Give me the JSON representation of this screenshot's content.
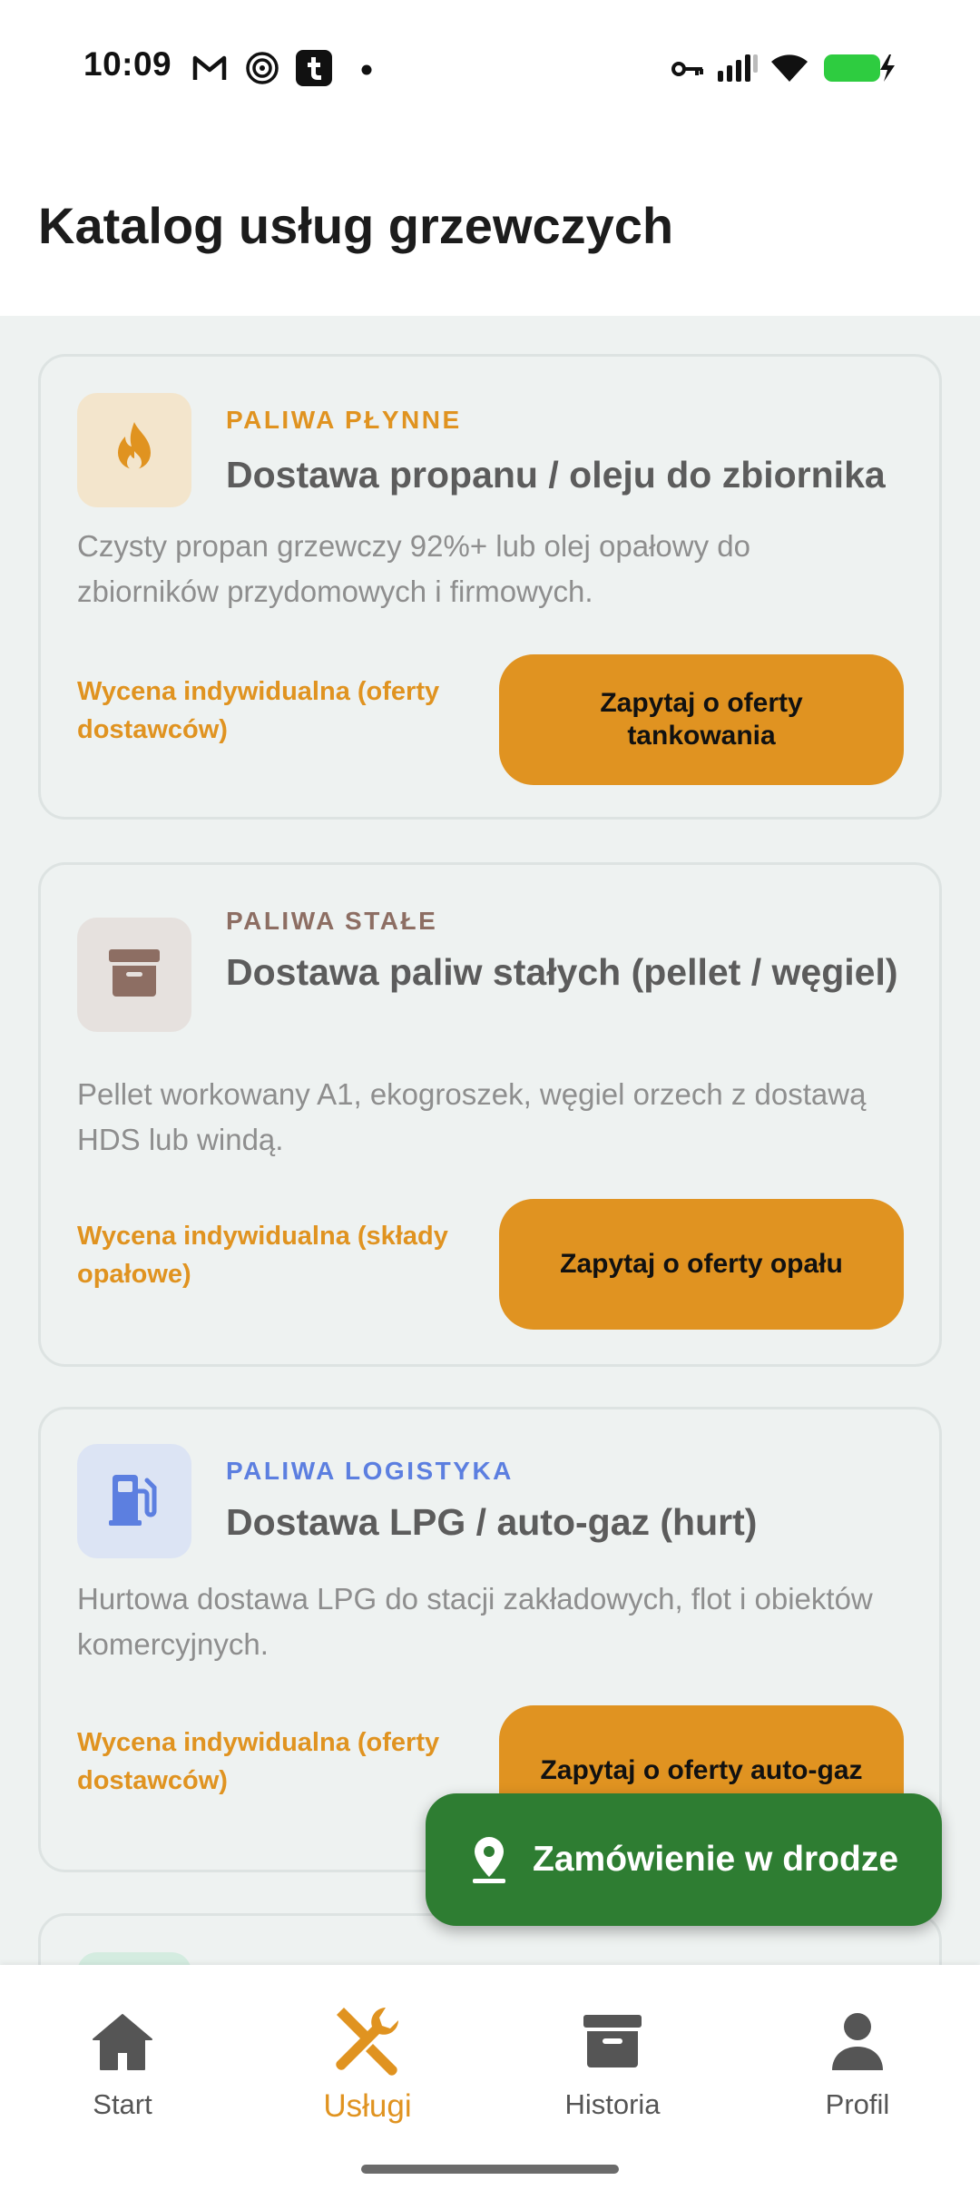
{
  "status_bar": {
    "time": "10:09",
    "icons": [
      "gmail-icon",
      "hotspot-icon",
      "tumblr-icon",
      "notification-dot-icon",
      "vpn-key-icon",
      "signal-icon",
      "wifi-icon",
      "battery-charging-icon"
    ]
  },
  "header": {
    "title": "Katalog usług grzewczych"
  },
  "cards": [
    {
      "category": "PALIWA PŁYNNE",
      "category_color": "#e09320",
      "icon": "flame-icon",
      "icon_bg": "#f3e5cc",
      "title": "Dostawa propanu / oleju do zbiornika",
      "description": "Czysty propan grzewczy 92%+ lub olej opałowy do zbiorników przydomowych i firmowych.",
      "price": "Wycena indywidualna (oferty dostawców)",
      "button": "Zapytaj o oferty tankowania"
    },
    {
      "category": "PALIWA STAŁE",
      "category_color": "#8d6e63",
      "icon": "archive-box-icon",
      "icon_bg": "#e6e1de",
      "title": "Dostawa paliw stałych (pellet / węgiel)",
      "description": "Pellet workowany A1, ekogroszek, węgiel orzech z dostawą HDS lub windą.",
      "price": "Wycena indywidualna (składy opałowe)",
      "button": "Zapytaj o oferty opału"
    },
    {
      "category": "PALIWA LOGISTYKA",
      "category_color": "#5c7fe0",
      "icon": "fuel-pump-icon",
      "icon_bg": "#dce4f4",
      "title": "Dostawa LPG / auto-gaz (hurt)",
      "description": "Hurtowa dostawa LPG do stacji zakładowych, flot i obiektów komercyjnych.",
      "price": "Wycena indywidualna (oferty dostawców)",
      "button": "Zapytaj o oferty auto-gaz"
    }
  ],
  "fab": {
    "label": "Zamówienie w drodze",
    "icon": "location-pin-icon",
    "color": "#2e7d32"
  },
  "bottom_nav": {
    "items": [
      {
        "label": "Start",
        "icon": "home-icon",
        "active": false
      },
      {
        "label": "Usługi",
        "icon": "tools-icon",
        "active": true
      },
      {
        "label": "Historia",
        "icon": "archive-icon",
        "active": false
      },
      {
        "label": "Profil",
        "icon": "person-icon",
        "active": false
      }
    ],
    "active_color": "#e09320"
  }
}
